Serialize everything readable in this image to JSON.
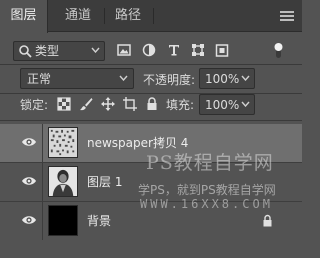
{
  "tabs": [
    {
      "label": "图层",
      "active": true
    },
    {
      "label": "通道",
      "active": false
    },
    {
      "label": "路径",
      "active": false
    }
  ],
  "panel_menu_icon": "hamburger-menu-icon",
  "filter": {
    "kind_label": "类型",
    "icons": [
      "image-filter-icon",
      "adjustment-filter-icon",
      "type-filter-icon",
      "shape-filter-icon",
      "smart-object-filter-icon"
    ],
    "toggle_on": true
  },
  "blend": {
    "mode": "正常",
    "opacity_label": "不透明度:",
    "opacity_value": "100%"
  },
  "lock": {
    "label": "锁定:",
    "icons": [
      "lock-transparent-pixels-icon",
      "lock-image-pixels-icon",
      "lock-position-icon",
      "lock-artboard-icon",
      "lock-all-icon"
    ],
    "fill_label": "填充:",
    "fill_value": "100%"
  },
  "layers": [
    {
      "name": "newspaper拷贝 4",
      "selected": true,
      "visible": true,
      "thumb": "noise-texture"
    },
    {
      "name": "图层 1",
      "selected": false,
      "visible": true,
      "thumb": "portrait-photo"
    },
    {
      "name": "背景",
      "selected": false,
      "visible": true,
      "thumb": "black-fill",
      "locked": true
    }
  ],
  "watermark": {
    "line1": "PS教程自学网",
    "line2": "学PS，就到PS教程自学网",
    "line3": "WWW.16XX8.COM"
  },
  "colors": {
    "panel_bg": "#535353",
    "tabbar_bg": "#3c3c3c",
    "selected_row": "#6f6f6f",
    "field_bg": "#454545"
  }
}
